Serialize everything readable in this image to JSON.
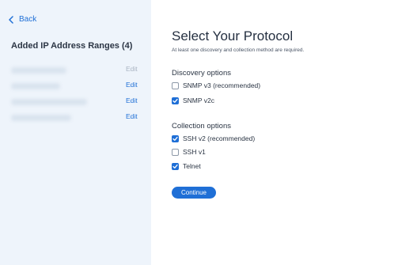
{
  "sidebar": {
    "back_label": "Back",
    "title": "Added IP Address Ranges (4)",
    "ranges": [
      {
        "edit_label": "Edit",
        "edit_enabled": false
      },
      {
        "edit_label": "Edit",
        "edit_enabled": true
      },
      {
        "edit_label": "Edit",
        "edit_enabled": true
      },
      {
        "edit_label": "Edit",
        "edit_enabled": true
      }
    ]
  },
  "main": {
    "title": "Select Your Protocol",
    "subtitle": "At least one discovery and collection method are required.",
    "discovery": {
      "title": "Discovery options",
      "options": [
        {
          "label": "SNMP v3 (recommended)",
          "checked": false
        },
        {
          "label": "SNMP v2c",
          "checked": true
        }
      ]
    },
    "collection": {
      "title": "Collection options",
      "options": [
        {
          "label": "SSH v2 (recommended)",
          "checked": true
        },
        {
          "label": "SSH v1",
          "checked": false
        },
        {
          "label": "Telnet",
          "checked": true
        }
      ]
    },
    "continue_label": "Continue"
  },
  "colors": {
    "accent": "#1f6fd6",
    "sidebar_bg": "#eef4fb",
    "disabled_text": "#a9b4c2"
  }
}
